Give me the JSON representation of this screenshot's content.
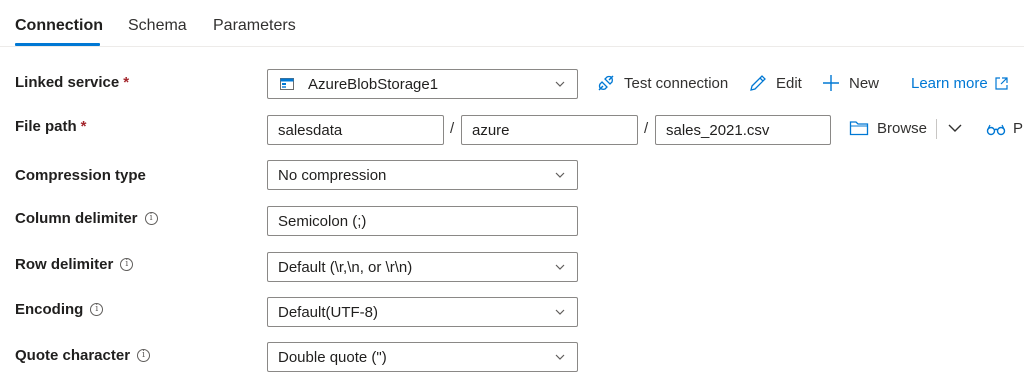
{
  "tabs": [
    {
      "label": "Connection",
      "active": true
    },
    {
      "label": "Schema",
      "active": false
    },
    {
      "label": "Parameters",
      "active": false
    }
  ],
  "linked_service": {
    "label": "Linked service",
    "required_mark": "*",
    "value": "AzureBlobStorage1",
    "actions": {
      "test_connection": "Test connection",
      "edit": "Edit",
      "new": "New",
      "learn_more": "Learn more"
    }
  },
  "file_path": {
    "label": "File path",
    "required_mark": "*",
    "container": "salesdata",
    "directory": "azure",
    "file": "sales_2021.csv",
    "separator": "/",
    "browse": "Browse",
    "preview_partial": "Pr"
  },
  "compression_type": {
    "label": "Compression type",
    "value": "No compression"
  },
  "column_delimiter": {
    "label": "Column delimiter",
    "value": "Semicolon (;)"
  },
  "row_delimiter": {
    "label": "Row delimiter",
    "value": "Default (\\r,\\n, or \\r\\n)"
  },
  "encoding": {
    "label": "Encoding",
    "value": "Default(UTF-8)"
  },
  "quote_character": {
    "label": "Quote character",
    "value": "Double quote (\")"
  },
  "info_glyph": "i",
  "colors": {
    "accent": "#0078d4",
    "required": "#a4262c",
    "border": "#8a8886"
  },
  "icons": {
    "storage": "storage-account-icon",
    "test": "plug-icon",
    "edit": "pencil-icon",
    "new": "plus-icon",
    "learn_more": "external-link-icon",
    "browse": "folder-icon",
    "preview": "glasses-icon",
    "chevron": "chevron-down-icon",
    "info": "info-icon"
  }
}
